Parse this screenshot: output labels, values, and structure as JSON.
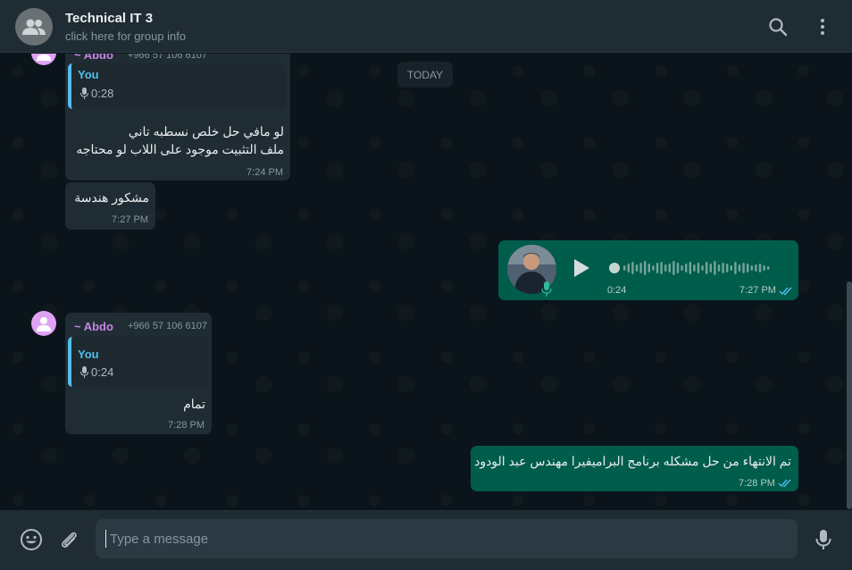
{
  "header": {
    "title": "Technical IT 3",
    "subtitle": "click here for group info",
    "avatar_icon": "group-icon",
    "search_icon": "search-icon",
    "menu_icon": "menu-dots-icon"
  },
  "chat": {
    "date_divider": "TODAY",
    "messages": [
      {
        "direction": "incoming",
        "sender": "~ Abdo",
        "phone": "+966 57 106 6107",
        "quote_author": "You",
        "quote_duration": "0:28",
        "lines": [
          "لو مافي حل خلص نسطبه تاني",
          "ملف التثبيت موجود على اللاب لو محتاجه"
        ],
        "time": "7:24 PM"
      },
      {
        "direction": "incoming",
        "text": "مشكور هندسة",
        "time": "7:27 PM"
      },
      {
        "direction": "outgoing",
        "type": "voice",
        "duration": "0:24",
        "time": "7:27 PM",
        "status": "read"
      },
      {
        "direction": "incoming",
        "sender": "~ Abdo",
        "phone": "+966 57 106 6107",
        "quote_author": "You",
        "quote_duration": "0:24",
        "text": "تمام",
        "time": "7:28 PM"
      },
      {
        "direction": "outgoing",
        "text": "تم الانتهاء من حل مشكله برنامج البراميفيرا مهندس عبد الودود",
        "time": "7:28 PM",
        "status": "read"
      }
    ]
  },
  "footer": {
    "placeholder": "Type a message",
    "emoji_icon": "emoji-icon",
    "attach_icon": "paperclip-icon",
    "mic_icon": "microphone-icon"
  },
  "colors": {
    "background": "#0b141a",
    "panel": "#202c33",
    "incoming_bubble": "#202c33",
    "outgoing_bubble": "#005c4b",
    "sender_name": "#c883e8",
    "quote_accent": "#53bdeb",
    "read_ticks": "#53bdeb"
  }
}
